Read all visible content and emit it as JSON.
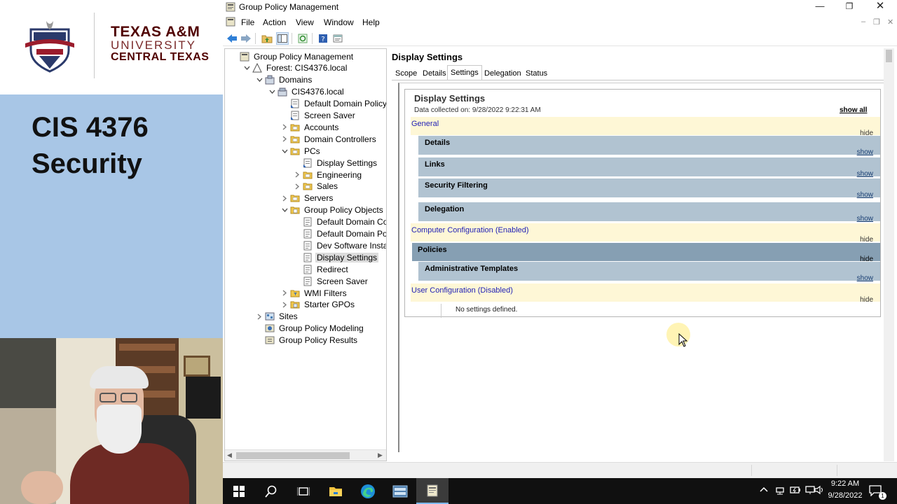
{
  "slide": {
    "logo": {
      "line1": "TEXAS A&M",
      "line2": "UNIVERSITY",
      "line3": "CENTRAL TEXAS"
    },
    "title_line1": "CIS 4376",
    "title_line2": "Security",
    "colors": {
      "panel": "#a8c6e6",
      "maroon": "#500000"
    }
  },
  "window": {
    "title": "Group Policy Management",
    "controls": {
      "minimize": "—",
      "restore": "❐",
      "close": "✕"
    },
    "menu": [
      "File",
      "Action",
      "View",
      "Window",
      "Help"
    ],
    "mdi_controls": {
      "minimize": "–",
      "restore": "❐",
      "close": "✕"
    },
    "toolbar": [
      {
        "icon": "back-arrow-icon"
      },
      {
        "icon": "forward-arrow-icon"
      },
      {
        "icon": "up-folder-icon"
      },
      {
        "icon": "show-hide-tree-icon"
      },
      {
        "icon": "refresh-icon"
      },
      {
        "icon": "help-icon"
      },
      {
        "icon": "properties-icon"
      }
    ]
  },
  "tree": {
    "items": [
      {
        "label": "Group Policy Management",
        "icon": "gpm-root-icon",
        "expander": ""
      },
      {
        "label": "Forest: CIS4376.local",
        "icon": "forest-icon",
        "expander": "expanded"
      },
      {
        "label": "Domains",
        "icon": "domains-icon",
        "expander": "expanded"
      },
      {
        "label": "CIS4376.local",
        "icon": "domain-icon",
        "expander": "expanded"
      },
      {
        "label": "Default Domain Policy",
        "icon": "gpo-link-icon",
        "expander": ""
      },
      {
        "label": "Screen Saver",
        "icon": "gpo-link-icon",
        "expander": ""
      },
      {
        "label": "Accounts",
        "icon": "ou-folder-icon",
        "expander": "collapsed"
      },
      {
        "label": "Domain Controllers",
        "icon": "ou-folder-icon",
        "expander": "collapsed"
      },
      {
        "label": "PCs",
        "icon": "ou-folder-icon",
        "expander": "expanded"
      },
      {
        "label": "Display Settings",
        "icon": "gpo-link-icon",
        "expander": ""
      },
      {
        "label": "Engineering",
        "icon": "ou-folder-icon",
        "expander": "collapsed"
      },
      {
        "label": "Sales",
        "icon": "ou-folder-icon",
        "expander": "collapsed"
      },
      {
        "label": "Servers",
        "icon": "ou-folder-icon",
        "expander": "collapsed"
      },
      {
        "label": "Group Policy Objects",
        "icon": "gpo-container-icon",
        "expander": "expanded"
      },
      {
        "label": "Default Domain Control",
        "icon": "gpo-icon",
        "expander": ""
      },
      {
        "label": "Default Domain Policy",
        "icon": "gpo-icon",
        "expander": ""
      },
      {
        "label": "Dev Software Install",
        "icon": "gpo-icon",
        "expander": ""
      },
      {
        "label": "Display Settings",
        "icon": "gpo-icon",
        "expander": "",
        "selected": true
      },
      {
        "label": "Redirect",
        "icon": "gpo-icon",
        "expander": ""
      },
      {
        "label": "Screen Saver",
        "icon": "gpo-icon",
        "expander": ""
      },
      {
        "label": "WMI Filters",
        "icon": "wmi-filter-icon",
        "expander": "collapsed"
      },
      {
        "label": "Starter GPOs",
        "icon": "starter-gpo-icon",
        "expander": "collapsed"
      },
      {
        "label": "Sites",
        "icon": "sites-icon",
        "expander": "collapsed"
      },
      {
        "label": "Group Policy Modeling",
        "icon": "modeling-icon",
        "expander": ""
      },
      {
        "label": "Group Policy Results",
        "icon": "results-icon",
        "expander": ""
      }
    ]
  },
  "details": {
    "header": "Display Settings",
    "tabs": [
      "Scope",
      "Details",
      "Settings",
      "Delegation",
      "Status"
    ],
    "active_tab": "Settings",
    "report": {
      "title": "Display Settings",
      "collected": "Data collected on: 9/28/2022 9:22:31 AM",
      "show_all": "show all",
      "general": {
        "label": "General",
        "toggle": "hide"
      },
      "details": {
        "label": "Details",
        "toggle": "show"
      },
      "links": {
        "label": "Links",
        "toggle": "show"
      },
      "security_filtering": {
        "label": "Security Filtering",
        "toggle": "show"
      },
      "delegation": {
        "label": "Delegation",
        "toggle": "show"
      },
      "computer_config": {
        "label": "Computer Configuration (Enabled)",
        "toggle": "hide"
      },
      "policies": {
        "label": "Policies",
        "toggle": "hide"
      },
      "admin_templates": {
        "label": "Administrative Templates",
        "toggle": "show"
      },
      "user_config": {
        "label": "User Configuration (Disabled)",
        "toggle": "hide"
      },
      "no_settings": "No settings defined."
    }
  },
  "taskbar": {
    "apps": [
      {
        "icon": "windows-start-icon"
      },
      {
        "icon": "search-icon"
      },
      {
        "icon": "task-view-icon"
      },
      {
        "icon": "file-explorer-icon"
      },
      {
        "icon": "edge-browser-icon"
      },
      {
        "icon": "server-manager-icon"
      },
      {
        "icon": "group-policy-icon",
        "active": true
      }
    ],
    "tray_icons": [
      "chevron-up-icon",
      "network-icon",
      "power-icon",
      "display-icon",
      "volume-icon"
    ],
    "time": "9:22 AM",
    "date": "9/28/2022",
    "notifications": "1",
    "colors": {
      "background": "#101010",
      "active": "#3b3b3b",
      "accent": "#7db8ee"
    }
  }
}
